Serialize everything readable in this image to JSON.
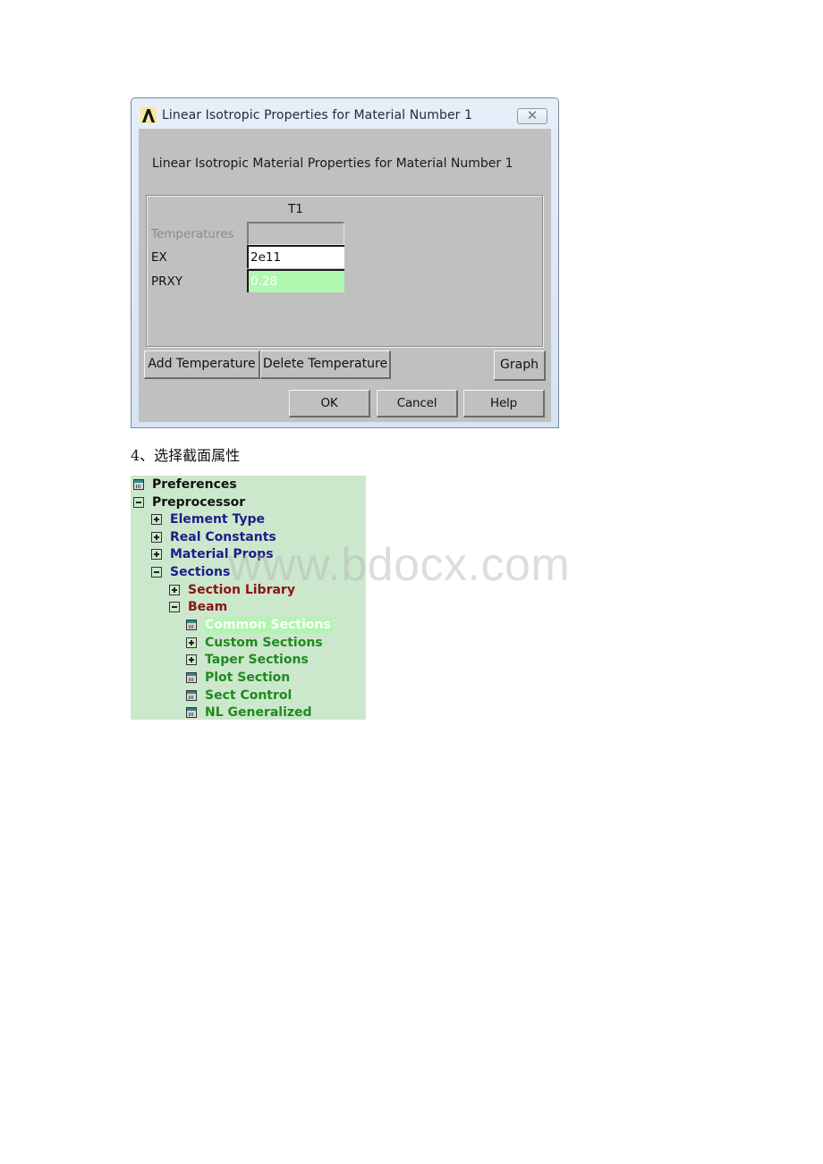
{
  "dialog": {
    "title": "Linear Isotropic Properties for Material Number 1",
    "close_symbol": "✕",
    "heading": "Linear Isotropic Material Properties for Material Number 1",
    "table": {
      "column_header": "T1",
      "rows": [
        {
          "label": "Temperatures",
          "value": "",
          "state": "disabled"
        },
        {
          "label": "EX",
          "value": "2e11",
          "state": "normal"
        },
        {
          "label": "PRXY",
          "value": "0.28",
          "state": "highlighted"
        }
      ]
    },
    "buttons": {
      "add_temperature": "Add Temperature",
      "delete_temperature": "Delete Temperature",
      "graph": "Graph",
      "ok": "OK",
      "cancel": "Cancel",
      "help": "Help"
    },
    "colors": {
      "client_bg": "#c0c0c0",
      "highlight_cell": "#b0f8b0"
    }
  },
  "caption": "4、选择截面属性",
  "tree": {
    "background": "#cce8cc",
    "items": [
      {
        "label": "Preferences",
        "icon": "dialog-icon",
        "level": 0,
        "color": "black"
      },
      {
        "label": "Preprocessor",
        "icon": "collapse-icon",
        "level": 0,
        "color": "black"
      },
      {
        "label": "Element Type",
        "icon": "expand-icon",
        "level": 1,
        "color": "navy"
      },
      {
        "label": "Real Constants",
        "icon": "expand-icon",
        "level": 1,
        "color": "navy"
      },
      {
        "label": "Material Props",
        "icon": "expand-icon",
        "level": 1,
        "color": "navy"
      },
      {
        "label": "Sections",
        "icon": "collapse-icon",
        "level": 1,
        "color": "navy"
      },
      {
        "label": "Section Library",
        "icon": "expand-icon",
        "level": 2,
        "color": "maroon"
      },
      {
        "label": "Beam",
        "icon": "collapse-icon",
        "level": 2,
        "color": "maroon"
      },
      {
        "label": "Common Sections",
        "icon": "dialog-icon",
        "level": 3,
        "color": "selected"
      },
      {
        "label": "Custom Sections",
        "icon": "expand-icon",
        "level": 3,
        "color": "green"
      },
      {
        "label": "Taper Sections",
        "icon": "expand-icon",
        "level": 3,
        "color": "green"
      },
      {
        "label": "Plot Section",
        "icon": "dialog-icon",
        "level": 3,
        "color": "green"
      },
      {
        "label": "Sect Control",
        "icon": "dialog-icon",
        "level": 3,
        "color": "green"
      },
      {
        "label": "NL Generalized",
        "icon": "dialog-icon",
        "level": 3,
        "color": "green"
      }
    ]
  },
  "watermark": "www.bdocx.com"
}
